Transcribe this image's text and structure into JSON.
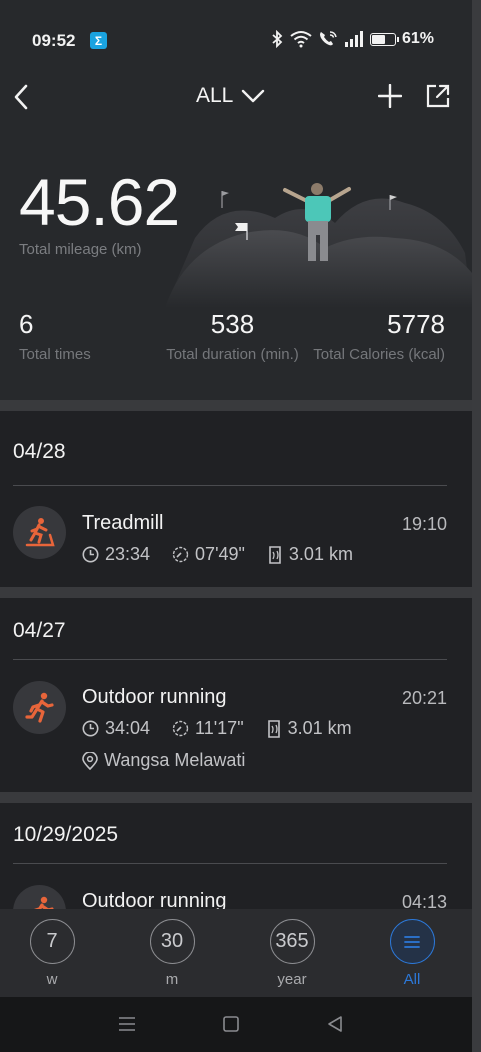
{
  "status_bar": {
    "time": "09:52",
    "app_icon_glyph": "Σ",
    "icons": [
      "bluetooth-icon",
      "wifi-icon",
      "wifi-call-icon",
      "signal-icon",
      "battery-icon"
    ],
    "battery_level": 0.61,
    "battery_text": "61%"
  },
  "nav": {
    "filter_label": "ALL",
    "back_icon": "chevron-left-icon",
    "filter_icon": "chevron-down-icon",
    "add_icon": "plus-icon",
    "share_icon": "share-icon"
  },
  "summary": {
    "mileage_value": "45.62",
    "mileage_label": "Total mileage (km)",
    "times_value": "6",
    "times_label": "Total times",
    "duration_value": "538",
    "duration_label": "Total duration (min.)",
    "calories_value": "5778",
    "calories_label": "Total Calories (kcal)"
  },
  "records": [
    {
      "date": "04/28",
      "title": "Treadmill",
      "time": "19:10",
      "icon": "treadmill-icon",
      "duration": "23:34",
      "pace": "07'49\"",
      "distance": "3.01 km"
    },
    {
      "date": "04/27",
      "title": "Outdoor running",
      "time": "20:21",
      "icon": "running-icon",
      "duration": "34:04",
      "pace": "11'17\"",
      "distance": "3.01 km",
      "location": "Wangsa Melawati"
    },
    {
      "date": "10/29/2025",
      "title": "Outdoor running",
      "time": "04:13",
      "icon": "running-icon"
    }
  ],
  "tabs": [
    {
      "value": "7",
      "label": "w"
    },
    {
      "value": "30",
      "label": "m"
    },
    {
      "value": "365",
      "label": "year"
    },
    {
      "value": "≡",
      "label": "All",
      "active": true
    }
  ],
  "colors": {
    "accent_orange": "#e8653a",
    "active_blue": "#2c78d8",
    "background": "#1f2022",
    "header_background": "#27292c"
  },
  "system_nav": [
    "recents-icon",
    "home-icon",
    "back-triangle-icon"
  ]
}
